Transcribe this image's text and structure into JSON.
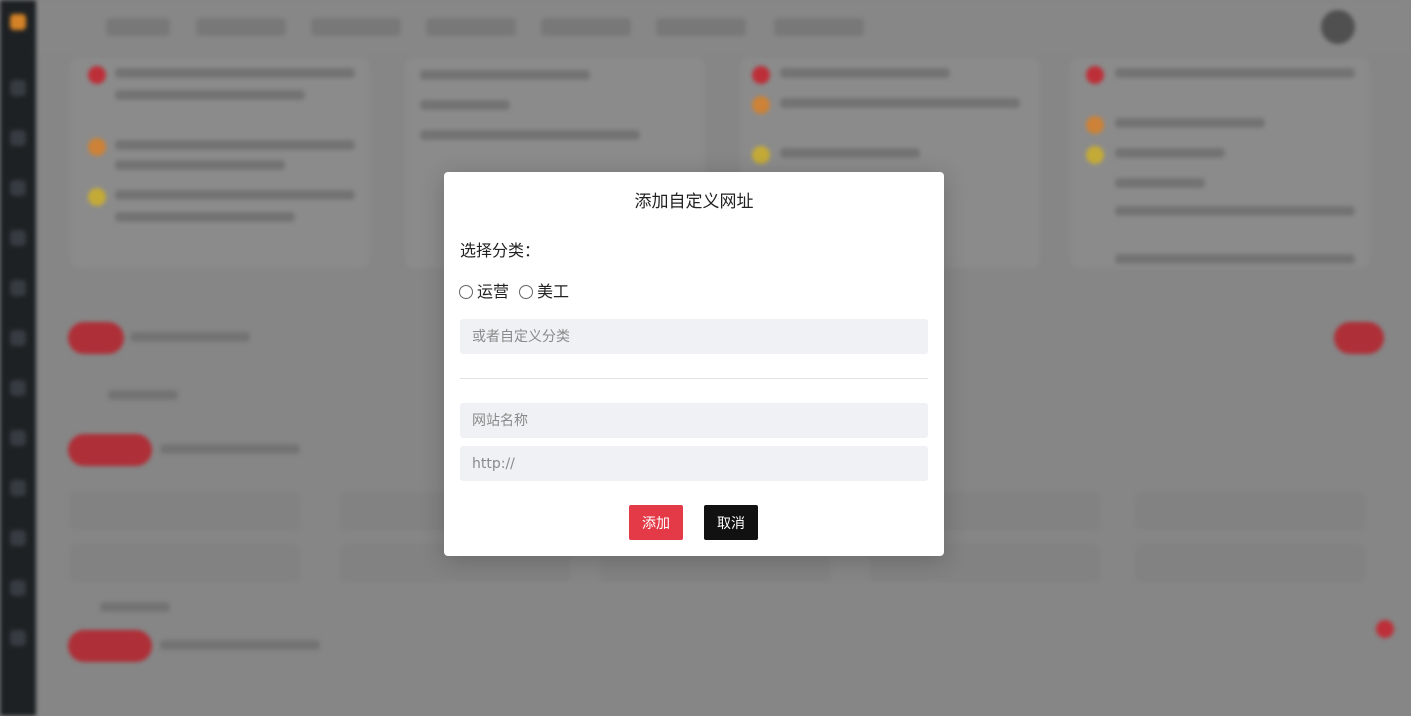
{
  "modal": {
    "title": "添加自定义网址",
    "category_label": "选择分类：",
    "categories": [
      {
        "label": "运营"
      },
      {
        "label": "美工"
      }
    ],
    "custom_category_placeholder": "或者自定义分类",
    "site_name_placeholder": "网站名称",
    "url_placeholder": "http://",
    "add_button": "添加",
    "cancel_button": "取消"
  },
  "colors": {
    "add_button": "#e43a48",
    "cancel_button": "#111111",
    "input_bg": "#f0f1f4"
  }
}
